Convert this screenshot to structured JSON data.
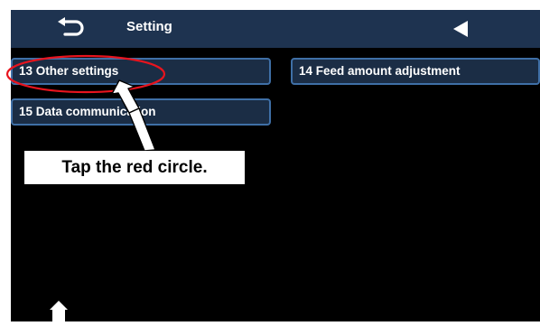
{
  "titlebar": {
    "title": "Setting",
    "back_icon": "return-arrow-icon",
    "prev_icon": "triangle-left-icon"
  },
  "menu": {
    "items": [
      {
        "label": "13 Other settings"
      },
      {
        "label": "14 Feed amount adjustment"
      },
      {
        "label": "15 Data communication"
      }
    ]
  },
  "footer": {
    "home_icon": "home-icon"
  },
  "annotation": {
    "text": "Tap the red circle.",
    "highlight_color": "#e8141e"
  },
  "colors": {
    "screen_bg": "#000000",
    "titlebar_bg": "#1e3350",
    "button_bg": "#1b2d45",
    "button_border": "#3f6fa6",
    "text": "#ffffff"
  }
}
